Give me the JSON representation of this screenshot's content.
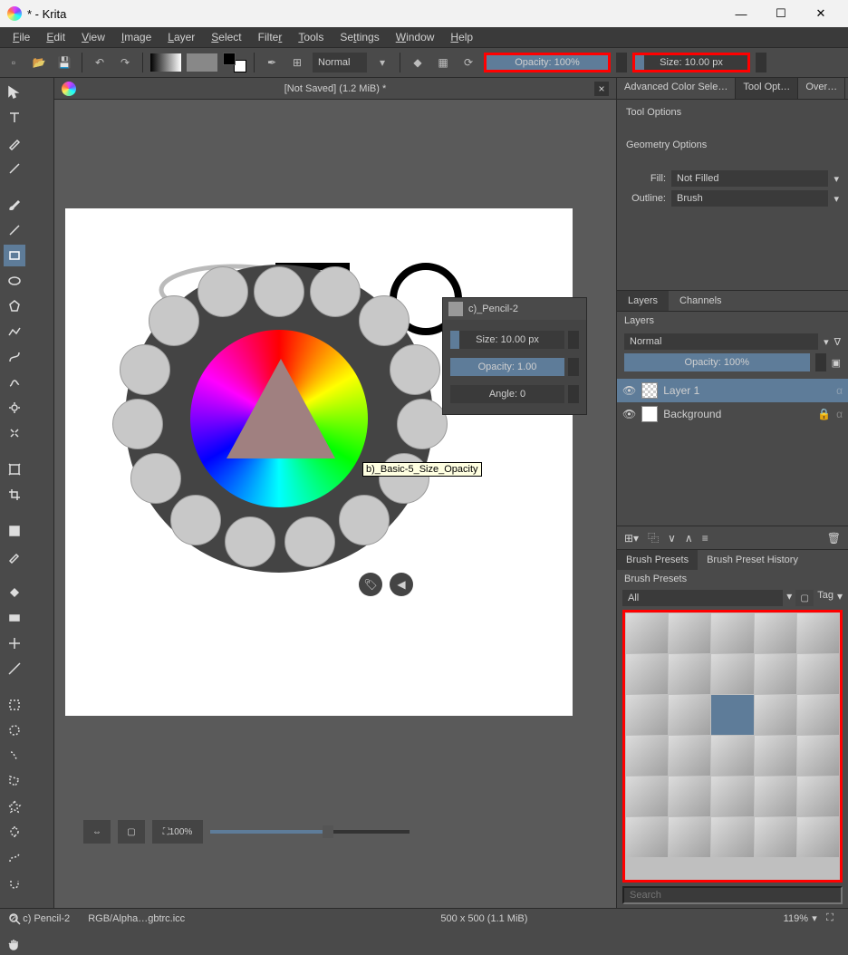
{
  "title": "* - Krita",
  "menus": [
    "File",
    "Edit",
    "View",
    "Image",
    "Layer",
    "Select",
    "Filter",
    "Tools",
    "Settings",
    "Window",
    "Help"
  ],
  "toolbar": {
    "blend": "Normal",
    "opacity": "Opacity: 100%",
    "size": "Size: 10.00 px"
  },
  "doc": {
    "title": "[Not Saved]  (1.2 MiB) *"
  },
  "popup": {
    "tooltip": "b)_Basic-5_Size_Opacity",
    "tag_btn": "◀"
  },
  "float": {
    "title": "c)_Pencil-2",
    "size": "Size: 10.00 px",
    "opacity": "Opacity: 1.00",
    "angle": "Angle: 0"
  },
  "zoom": "100%",
  "right": {
    "tabs": [
      "Advanced Color Sele…",
      "Tool Opt…",
      "Over…"
    ],
    "tool_options": "Tool Options",
    "geo_hdr": "Geometry Options",
    "fill_label": "Fill:",
    "fill_value": "Not Filled",
    "outline_label": "Outline:",
    "outline_value": "Brush",
    "layers_tab": "Layers",
    "channels_tab": "Channels",
    "layers_hdr": "Layers",
    "layer_blend": "Normal",
    "layer_opacity": "Opacity:  100%",
    "layer1": "Layer 1",
    "layer_bg": "Background",
    "presets_tab": "Brush Presets",
    "history_tab": "Brush Preset History",
    "presets_hdr": "Brush Presets",
    "filter_all": "All",
    "tag_btn": "Tag",
    "search_ph": "Search"
  },
  "status": {
    "brush": "c) Pencil-2",
    "profile": "RGB/Alpha…gbtrc.icc",
    "dims": "500 x 500 (1.1 MiB)",
    "zoom": "119%"
  }
}
